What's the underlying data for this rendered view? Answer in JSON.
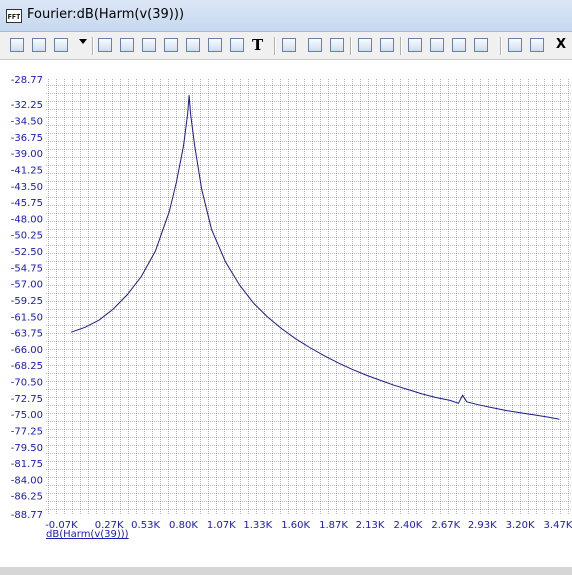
{
  "window": {
    "title": "Fourier:dB(Harm(v(39)))",
    "icon_text": "FFT"
  },
  "toolbar": {
    "buttons": [
      {
        "name": "select-arrow-icon"
      },
      {
        "name": "pan-hand-icon"
      },
      {
        "name": "3d-box-icon"
      },
      {
        "name": "dropdown-arrow-icon"
      },
      {
        "name": "zoom-fit-icon"
      },
      {
        "name": "zoom-icon"
      },
      {
        "name": "zoom-area-icon"
      },
      {
        "name": "zoom-x-icon"
      },
      {
        "name": "zoom-y-icon"
      },
      {
        "name": "zoom-xy-icon"
      },
      {
        "name": "function-icon"
      },
      {
        "name": "text-tool-icon"
      },
      {
        "name": "properties-icon"
      },
      {
        "name": "cursor-a-icon"
      },
      {
        "name": "cursor-b-icon"
      },
      {
        "name": "frame-icon"
      },
      {
        "name": "grid-toggle-icon"
      },
      {
        "name": "layout-1-icon"
      },
      {
        "name": "layout-2-icon"
      },
      {
        "name": "layout-3-icon"
      },
      {
        "name": "layout-4-icon"
      },
      {
        "name": "horizontal-split-icon"
      },
      {
        "name": "crosshair-icon"
      },
      {
        "name": "close-icon"
      }
    ]
  },
  "chart_data": {
    "type": "line",
    "title": "",
    "xlabel": "",
    "ylabel": "",
    "trace_label": "dB(Harm(v(39)))",
    "x_tick_labels": [
      "-0.07K",
      "0.27K",
      "0.53K",
      "0.80K",
      "1.07K",
      "1.33K",
      "1.60K",
      "1.87K",
      "2.13K",
      "2.40K",
      "2.67K",
      "2.93K",
      "3.20K",
      "3.47K"
    ],
    "x_ticks": [
      -70,
      270,
      530,
      800,
      1070,
      1330,
      1600,
      1870,
      2130,
      2400,
      2670,
      2930,
      3200,
      3470
    ],
    "y_tick_labels": [
      "-28.77",
      "-32.25",
      "-34.50",
      "-36.75",
      "-39.00",
      "-41.25",
      "-43.50",
      "-45.75",
      "-48.00",
      "-50.25",
      "-52.50",
      "-54.75",
      "-57.00",
      "-59.25",
      "-61.50",
      "-63.75",
      "-66.00",
      "-68.25",
      "-70.50",
      "-72.75",
      "-75.00",
      "-77.25",
      "-79.50",
      "-81.75",
      "-84.00",
      "-86.25",
      "-88.77"
    ],
    "y_ticks": [
      -28.77,
      -32.25,
      -34.5,
      -36.75,
      -39,
      -41.25,
      -43.5,
      -45.75,
      -48,
      -50.25,
      -52.5,
      -54.75,
      -57,
      -59.25,
      -61.5,
      -63.75,
      -66,
      -68.25,
      -70.5,
      -72.75,
      -75,
      -77.25,
      -79.5,
      -81.75,
      -84,
      -86.25,
      -88.77
    ],
    "xlim": [
      -180,
      3570
    ],
    "ylim": [
      -88.77,
      -28.77
    ],
    "grid": true,
    "series": [
      {
        "color": "#1a1a8c",
        "points": [
          [
            0,
            -63.7
          ],
          [
            100,
            -63
          ],
          [
            200,
            -62
          ],
          [
            300,
            -60.5
          ],
          [
            400,
            -58.5
          ],
          [
            500,
            -56
          ],
          [
            600,
            -52.5
          ],
          [
            700,
            -47
          ],
          [
            750,
            -43
          ],
          [
            800,
            -38
          ],
          [
            830,
            -33.5
          ],
          [
            840,
            -31
          ],
          [
            850,
            -33.5
          ],
          [
            880,
            -38
          ],
          [
            930,
            -44
          ],
          [
            1000,
            -49.5
          ],
          [
            1100,
            -54
          ],
          [
            1200,
            -57.2
          ],
          [
            1300,
            -59.7
          ],
          [
            1400,
            -61.6
          ],
          [
            1500,
            -63.2
          ],
          [
            1600,
            -64.6
          ],
          [
            1700,
            -65.8
          ],
          [
            1800,
            -66.9
          ],
          [
            1900,
            -67.9
          ],
          [
            2000,
            -68.8
          ],
          [
            2100,
            -69.6
          ],
          [
            2200,
            -70.3
          ],
          [
            2300,
            -71
          ],
          [
            2400,
            -71.6
          ],
          [
            2500,
            -72.2
          ],
          [
            2600,
            -72.7
          ],
          [
            2700,
            -73.1
          ],
          [
            2760,
            -73.5
          ],
          [
            2790,
            -72.4
          ],
          [
            2820,
            -73.3
          ],
          [
            2900,
            -73.7
          ],
          [
            3000,
            -74.1
          ],
          [
            3100,
            -74.5
          ],
          [
            3200,
            -74.8
          ],
          [
            3300,
            -75.1
          ],
          [
            3400,
            -75.4
          ],
          [
            3480,
            -75.7
          ]
        ]
      }
    ]
  }
}
